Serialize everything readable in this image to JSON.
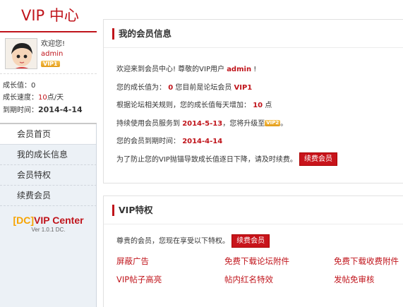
{
  "sidebar": {
    "title": "VIP 中心",
    "welcome": "欢迎您!",
    "username": "admin",
    "vip_badge": "VIP1",
    "stats": {
      "growth_label": "成长值：",
      "growth_value": "0",
      "speed_label": "成长速度：",
      "speed_value": "10",
      "speed_unit": "点/天",
      "expire_label": "到期时间：",
      "expire_value": "2014-4-14"
    },
    "nav": [
      {
        "label": "会员首页"
      },
      {
        "label": "我的成长信息"
      },
      {
        "label": "会员特权"
      },
      {
        "label": "续费会员"
      }
    ],
    "brand_dc": "[DC]",
    "brand_main": "VIP Center",
    "brand_version": "Ver 1.0.1 DC."
  },
  "info_panel": {
    "title": "我的会员信息",
    "line1_pre": "欢迎来到会员中心! 尊敬的VIP用户 ",
    "line1_user": "admin",
    "line1_post": " !",
    "line2_pre": "您的成长值为： ",
    "line2_value": "0",
    "line2_mid": " 您目前是论坛会员 ",
    "line2_level": "VIP1",
    "line3_pre": "根据论坛相关规则，您的成长值每天增加： ",
    "line3_value": "10",
    "line3_post": " 点",
    "line4_pre": "持续使用会员服务到 ",
    "line4_date": "2014-5-13",
    "line4_mid": "，您将升级至",
    "line4_badge": "VIP2",
    "line4_post": "。",
    "line5_pre": "您的会员到期时间： ",
    "line5_date": "2014-4-14",
    "line6_text": "为了防止您的VIP抛锚导致成长值逐日下降，请及时续费。",
    "renew_button": "续费会员"
  },
  "privilege_panel": {
    "title": "VIP特权",
    "intro": "尊贵的会员，您现在享受以下特权。",
    "renew_button": "续费会员",
    "items": [
      {
        "label": "屏蔽广告"
      },
      {
        "label": "免费下载论坛附件"
      },
      {
        "label": "免费下载收费附件"
      },
      {
        "label": "VIP帖子高亮"
      },
      {
        "label": "帖内红名特效"
      },
      {
        "label": "发帖免审核"
      }
    ]
  },
  "colors": {
    "accent": "#c0141b",
    "nav_bg": "#ecf1f6",
    "brand_dc": "#f7a400"
  }
}
